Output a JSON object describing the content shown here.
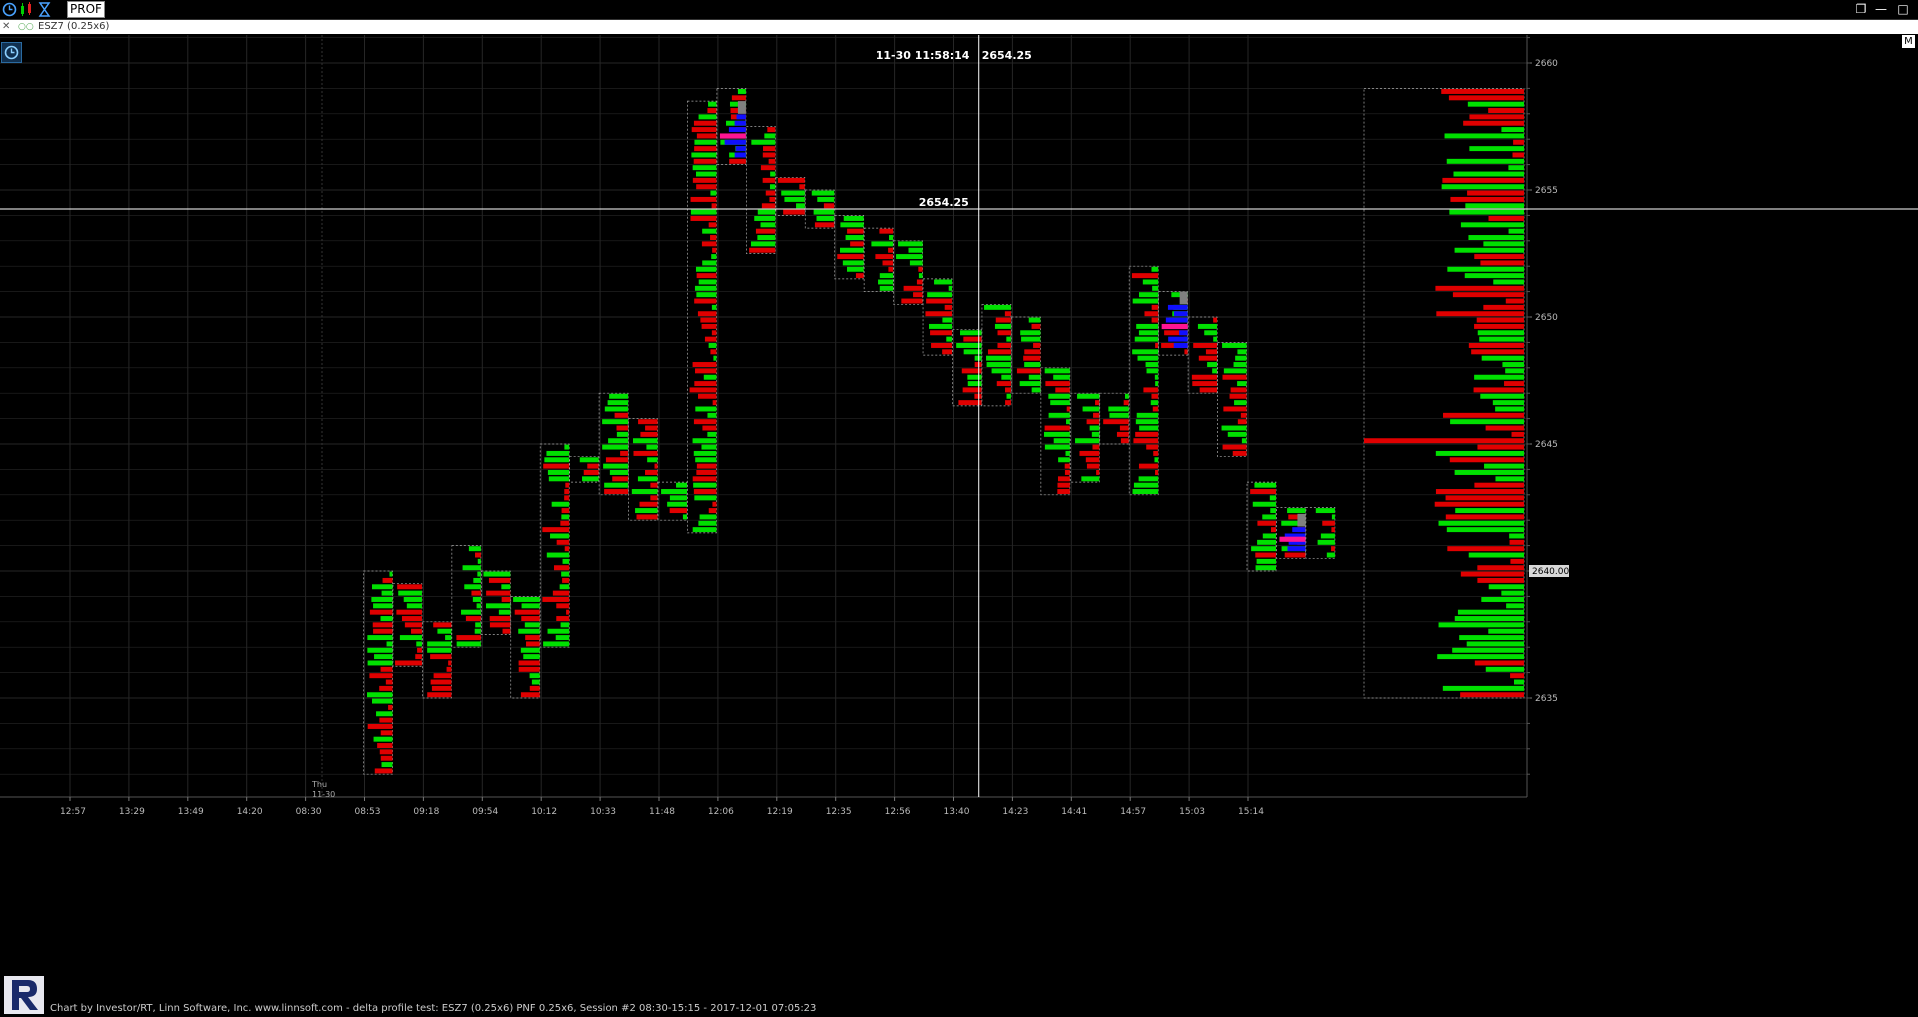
{
  "toolbar": {
    "prof_label": "PROF",
    "icons": [
      "clock-icon",
      "bar-chart-icon",
      "hourglass-icon"
    ],
    "window_icons": [
      "restore-icon",
      "minimize-icon",
      "maximize-icon"
    ]
  },
  "tab": {
    "label": "ESZ7 (0.25x6)"
  },
  "side_button": "M",
  "crosshair": {
    "time_label": "11-30 11:58:14",
    "price_label": "2654.25",
    "price": 2654.25,
    "time_slot": 15.7
  },
  "last_price_label": "2640.00",
  "footer": "Chart by Investor/RT, Linn Software, Inc. www.linnsoft.com - delta profile test: ESZ7 (0.25x6) PNF 0.25x6, Session #2 08:30-15:15 - 2017-12-01 07:05:23",
  "colors": {
    "buy": "#00e000",
    "sell": "#e00000",
    "poc": "#ff1493",
    "value_area": "#1010ff",
    "other": "#808080",
    "grid": "#262626",
    "crosshair": "#ffffff"
  },
  "chart_data": {
    "type": "bar",
    "subtype": "delta volume profile (PNF)",
    "ylim": [
      2632.0,
      2662.0
    ],
    "y_ticks": [
      2635,
      2640,
      2645,
      2650,
      2655,
      2660
    ],
    "x_ticks": [
      "12:57",
      "13:29",
      "13:49",
      "14:20",
      "08:30",
      "08:53",
      "09:18",
      "09:54",
      "10:12",
      "10:33",
      "11:48",
      "12:06",
      "12:19",
      "12:35",
      "12:56",
      "13:40",
      "14:23",
      "14:41",
      "14:57",
      "15:03",
      "15:14"
    ],
    "session_marker": [
      "Thu",
      "11-30"
    ],
    "columns": [
      {
        "slot": 5.0,
        "low": 2632.0,
        "high": 2640.0
      },
      {
        "slot": 5.5,
        "low": 2636.25,
        "high": 2639.5
      },
      {
        "slot": 6.0,
        "low": 2635.0,
        "high": 2638.0
      },
      {
        "slot": 6.5,
        "low": 2637.0,
        "high": 2641.0
      },
      {
        "slot": 7.0,
        "low": 2637.5,
        "high": 2640.0
      },
      {
        "slot": 7.5,
        "low": 2635.0,
        "high": 2639.0
      },
      {
        "slot": 8.0,
        "low": 2637.0,
        "high": 2645.0
      },
      {
        "slot": 8.5,
        "low": 2643.5,
        "high": 2644.5
      },
      {
        "slot": 9.0,
        "low": 2643.0,
        "high": 2647.0
      },
      {
        "slot": 9.5,
        "low": 2642.0,
        "high": 2646.0
      },
      {
        "slot": 10.0,
        "low": 2642.0,
        "high": 2643.5
      },
      {
        "slot": 10.5,
        "low": 2641.5,
        "high": 2658.5
      },
      {
        "slot": 11.0,
        "low": 2656.0,
        "high": 2659.0
      },
      {
        "slot": 11.5,
        "low": 2652.5,
        "high": 2657.5
      },
      {
        "slot": 12.0,
        "low": 2654.0,
        "high": 2655.5
      },
      {
        "slot": 12.5,
        "low": 2653.5,
        "high": 2655.0
      },
      {
        "slot": 13.0,
        "low": 2651.5,
        "high": 2654.0
      },
      {
        "slot": 13.5,
        "low": 2651.0,
        "high": 2653.5
      },
      {
        "slot": 14.0,
        "low": 2650.5,
        "high": 2653.0
      },
      {
        "slot": 14.5,
        "low": 2648.5,
        "high": 2651.5
      },
      {
        "slot": 15.0,
        "low": 2646.5,
        "high": 2649.5
      },
      {
        "slot": 15.5,
        "low": 2646.5,
        "high": 2650.5
      },
      {
        "slot": 16.0,
        "low": 2647.0,
        "high": 2650.0
      },
      {
        "slot": 16.5,
        "low": 2643.0,
        "high": 2648.0
      },
      {
        "slot": 17.0,
        "low": 2643.5,
        "high": 2647.0
      },
      {
        "slot": 17.5,
        "low": 2645.0,
        "high": 2647.0
      },
      {
        "slot": 18.0,
        "low": 2643.0,
        "high": 2652.0
      },
      {
        "slot": 18.5,
        "low": 2648.5,
        "high": 2651.0
      },
      {
        "slot": 19.0,
        "low": 2647.0,
        "high": 2650.0
      },
      {
        "slot": 19.5,
        "low": 2644.5,
        "high": 2649.0
      },
      {
        "slot": 20.0,
        "low": 2640.0,
        "high": 2643.5
      },
      {
        "slot": 20.5,
        "low": 2640.5,
        "high": 2642.5
      },
      {
        "slot": 21.0,
        "low": 2640.5,
        "high": 2642.5
      }
    ],
    "volume_profile": {
      "low": 2635.0,
      "high": 2659.0,
      "step": 0.25,
      "highlighted_level": 2645.0
    }
  }
}
